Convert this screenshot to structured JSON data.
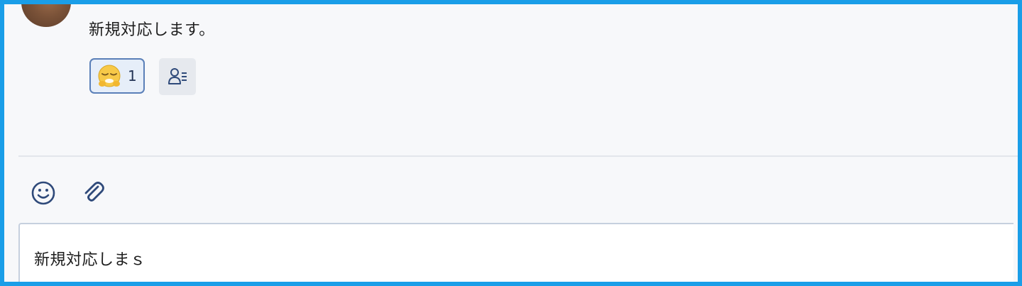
{
  "message": {
    "text": "新規対応します。"
  },
  "reactions": [
    {
      "emoji": "sleeping-face-emoji",
      "count": "1"
    }
  ],
  "toolbar": {
    "emoji_icon": "smiley-icon",
    "attach_icon": "paperclip-icon"
  },
  "composer": {
    "value": "新規対応しまｓ"
  },
  "colors": {
    "frame": "#1a9ee8",
    "background": "#f7f8fa",
    "reaction_border": "#5a7fb8",
    "reaction_bg": "#e6eef9",
    "icon": "#2f4a7a"
  }
}
